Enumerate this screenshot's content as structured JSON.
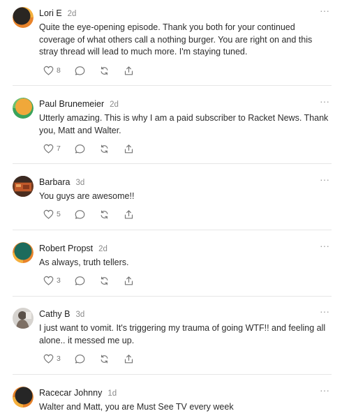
{
  "comments": [
    {
      "name": "Lori E",
      "time": "2d",
      "text": "Quite the eye-opening episode. Thank you both for your continued coverage of what others call a nothing burger. You are right on and this stray thread will lead to much more. I'm staying tuned.",
      "likes": "8",
      "avatar": "dark-circle-orange-rim"
    },
    {
      "name": "Paul Brunemeier",
      "time": "2d",
      "text": "Utterly amazing. This is why I am a paid subscriber to Racket News. Thank you, Matt and Walter.",
      "likes": "7",
      "avatar": "orange-circle-green-rim"
    },
    {
      "name": "Barbara",
      "time": "3d",
      "text": "You guys are awesome!!",
      "likes": "5",
      "avatar": "photo-thumbnail"
    },
    {
      "name": "Robert Propst",
      "time": "2d",
      "text": "As always, truth tellers.",
      "likes": "3",
      "avatar": "teal-circle-orange-rim"
    },
    {
      "name": "Cathy B",
      "time": "3d",
      "text": "I just want to vomit. It's triggering my trauma of going WTF!! and feeling all alone.. it messed me up.",
      "likes": "3",
      "avatar": "photo-thumbnail"
    },
    {
      "name": "Racecar Johnny",
      "time": "1d",
      "text": "Walter and Matt, you are Must See TV every week",
      "likes": "",
      "avatar": "dark-circle-orange-rim"
    }
  ],
  "more_label": "···",
  "colors": {
    "accent_orange": "#e8832a",
    "green": "#3aa35b",
    "teal": "#1c6b5c",
    "separator": "#e6e6e6",
    "muted": "#757575"
  }
}
